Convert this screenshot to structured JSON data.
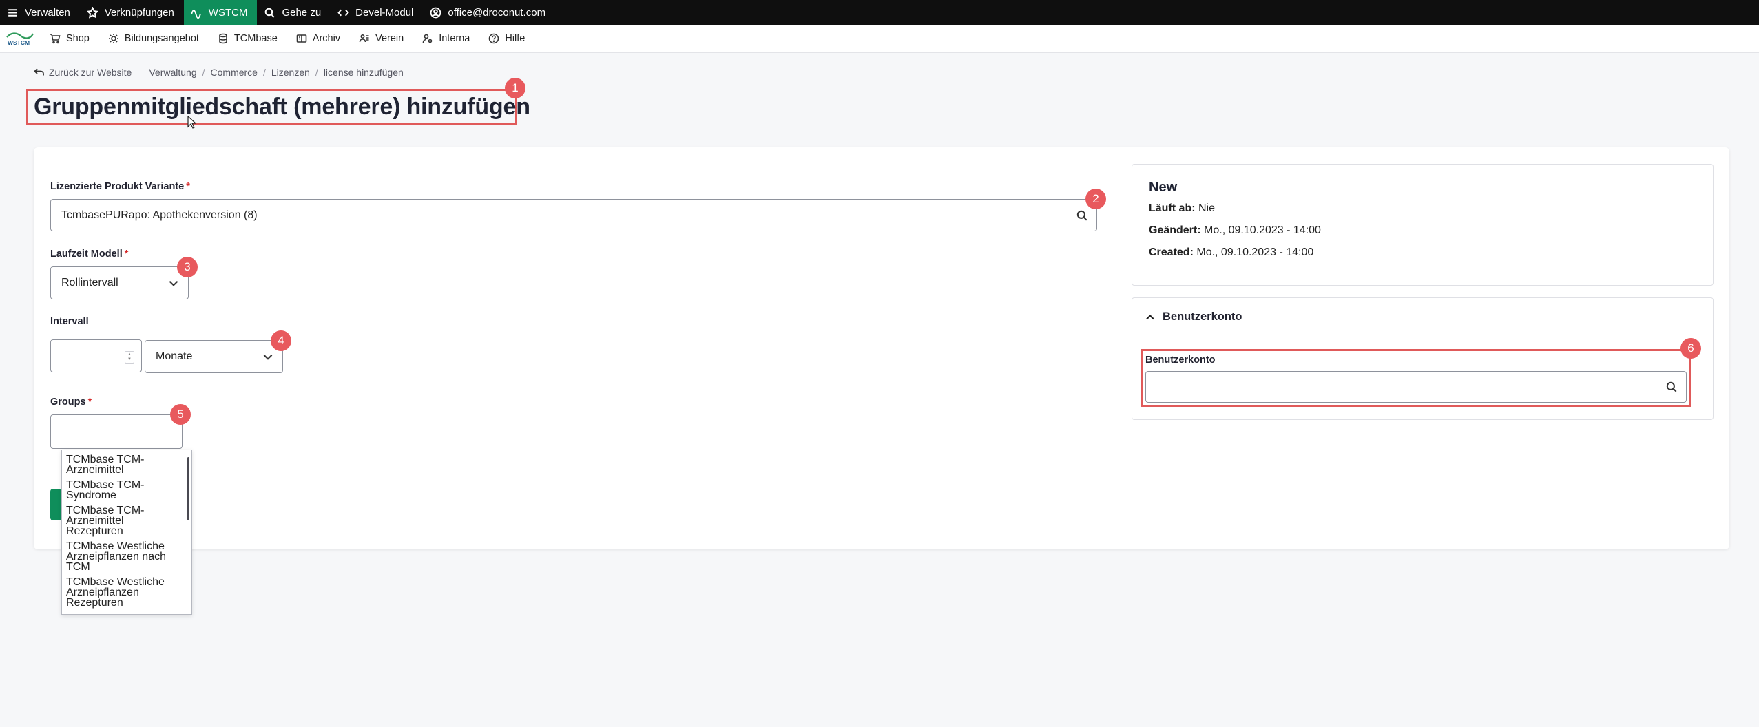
{
  "toolbar": {
    "items": [
      {
        "label": "Verwalten",
        "icon": "menu-icon"
      },
      {
        "label": "Verknüpfungen",
        "icon": "star-icon"
      },
      {
        "label": "WSTCM",
        "icon": "wave-icon"
      },
      {
        "label": "Gehe zu",
        "icon": "search-icon"
      },
      {
        "label": "Devel-Modul",
        "icon": "code-icon"
      },
      {
        "label": "office@droconut.com",
        "icon": "user-icon"
      }
    ]
  },
  "subnav": {
    "logo_text": "WSTCM",
    "items": [
      {
        "label": "Shop",
        "icon": "cart-icon"
      },
      {
        "label": "Bildungsangebot",
        "icon": "bulb-icon"
      },
      {
        "label": "TCMbase",
        "icon": "database-icon"
      },
      {
        "label": "Archiv",
        "icon": "book-icon"
      },
      {
        "label": "Verein",
        "icon": "people-icon"
      },
      {
        "label": "Interna",
        "icon": "person-gear-icon"
      },
      {
        "label": "Hilfe",
        "icon": "help-icon"
      }
    ]
  },
  "breadcrumb": {
    "back": "Zurück zur Website",
    "items": [
      "Verwaltung",
      "Commerce",
      "Lizenzen",
      "license hinzufügen"
    ]
  },
  "page": {
    "title": "Gruppenmitgliedschaft (mehrere) hinzufügen"
  },
  "badges": [
    "1",
    "2",
    "3",
    "4",
    "5",
    "6"
  ],
  "form": {
    "product_variant": {
      "label": "Lizenzierte Produkt Variante",
      "required_mark": "*",
      "value": "TcmbasePURapo: Apothekenversion (8)"
    },
    "runtime_model": {
      "label": "Laufzeit Modell",
      "required_mark": "*",
      "value": "Rollintervall"
    },
    "interval": {
      "label": "Intervall",
      "number_value": "",
      "unit_value": "Monate"
    },
    "groups": {
      "label": "Groups",
      "required_mark": "*",
      "value": "",
      "options": [
        "TCMbase TCM-Arzneimittel",
        "TCMbase TCM-Syndrome",
        "TCMbase TCM-Arzneimittel Rezepturen",
        "TCMbase Westliche Arzneipflanzen nach TCM",
        "TCMbase Westliche Arzneipflanzen Rezepturen"
      ]
    }
  },
  "meta": {
    "status": "New",
    "expires_label": "Läuft ab:",
    "expires_value": "Nie",
    "changed_label": "Geändert:",
    "changed_value": "Mo., 09.10.2023 - 14:00",
    "created_label": "Created:",
    "created_value": "Mo., 09.10.2023 - 14:00"
  },
  "account": {
    "section_title": "Benutzerkonto",
    "field_label": "Benutzerkonto",
    "value": ""
  },
  "colors": {
    "toolbar_bg": "#0f0f0f",
    "active_green": "#0f8e5b",
    "highlight_red": "#e05a5a",
    "badge_red": "#e8595d",
    "required_red": "#d62b2b"
  }
}
